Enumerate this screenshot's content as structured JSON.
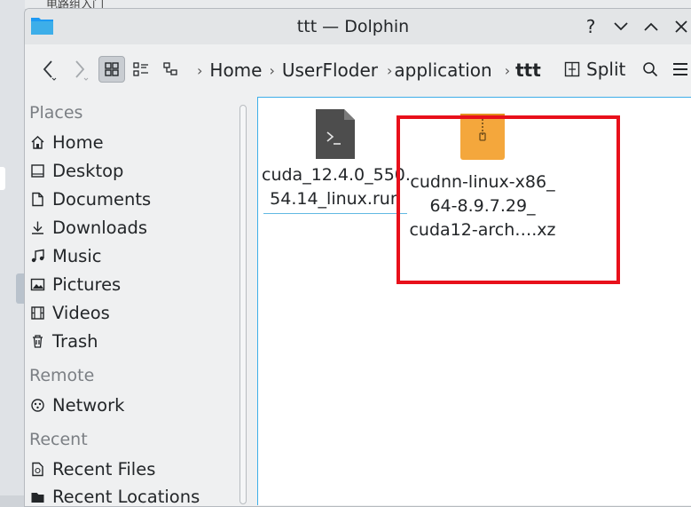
{
  "background": {
    "crumb_text": "电路组入门"
  },
  "window": {
    "title": "ttt — Dolphin",
    "buttons": {
      "help": "?",
      "minimize": "⌄",
      "maximize": "⌃",
      "close": "✕"
    }
  },
  "toolbar": {
    "back": "‹",
    "forward": "›",
    "breadcrumb": [
      "Home",
      "UserFloder",
      "application",
      "ttt"
    ],
    "split_label": "Split"
  },
  "sidebar": {
    "places_header": "Places",
    "places": [
      {
        "label": "Home",
        "icon": "home-icon"
      },
      {
        "label": "Desktop",
        "icon": "desktop-icon"
      },
      {
        "label": "Documents",
        "icon": "documents-icon"
      },
      {
        "label": "Downloads",
        "icon": "downloads-icon"
      },
      {
        "label": "Music",
        "icon": "music-icon"
      },
      {
        "label": "Pictures",
        "icon": "pictures-icon"
      },
      {
        "label": "Videos",
        "icon": "videos-icon"
      },
      {
        "label": "Trash",
        "icon": "trash-icon"
      }
    ],
    "remote_header": "Remote",
    "remote": [
      {
        "label": "Network",
        "icon": "network-icon"
      }
    ],
    "recent_header": "Recent",
    "recent": [
      {
        "label": "Recent Files",
        "icon": "recent-files-icon"
      },
      {
        "label": "Recent Locations",
        "icon": "recent-locations-icon"
      }
    ]
  },
  "files": [
    {
      "name_line1": "cuda_12.4.0_550.",
      "name_line2": "54.14_linux.run",
      "icon": "script-file-icon"
    },
    {
      "name_line1": "cudnn-linux-x86_",
      "name_line2": "64-8.9.7.29_",
      "name_line3": "cuda12-arch….xz",
      "icon": "archive-file-icon"
    }
  ],
  "colors": {
    "accent": "#3daee9",
    "highlight": "#e8101b",
    "archive": "#f4a73c"
  }
}
